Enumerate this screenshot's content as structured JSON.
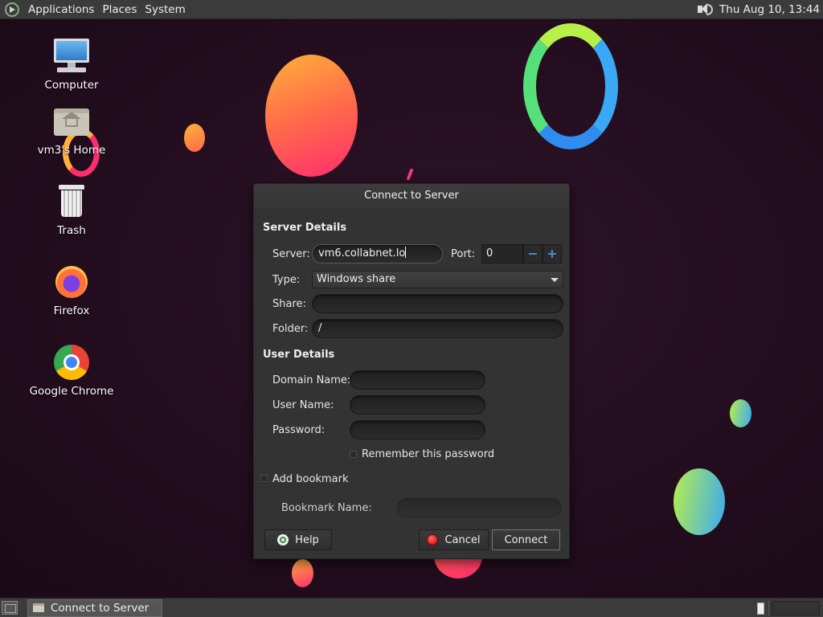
{
  "top_panel": {
    "menus": [
      "Applications",
      "Places",
      "System"
    ],
    "clock": "Thu Aug 10, 13:44",
    "volume_icon": "speaker-icon"
  },
  "desktop_icons": [
    {
      "label": "Computer",
      "icon": "computer-icon"
    },
    {
      "label": "vm3's Home",
      "icon": "home-folder-icon"
    },
    {
      "label": "Trash",
      "icon": "trash-icon"
    },
    {
      "label": "Firefox",
      "icon": "firefox-icon"
    },
    {
      "label": "Google Chrome",
      "icon": "chrome-icon"
    }
  ],
  "dialog": {
    "title": "Connect to Server",
    "server_details_heading": "Server Details",
    "server_label": "Server:",
    "server_value": "vm6.collabnet.lo",
    "port_label": "Port:",
    "port_value": "0",
    "port_decrement": "−",
    "port_increment": "+",
    "type_label": "Type:",
    "type_value": "Windows share",
    "share_label": "Share:",
    "share_value": "",
    "folder_label": "Folder:",
    "folder_value": "/",
    "user_details_heading": "User Details",
    "domain_label": "Domain Name:",
    "domain_value": "",
    "username_label": "User Name:",
    "username_value": "",
    "password_label": "Password:",
    "password_value": "",
    "remember_label": "Remember this password",
    "remember_checked": false,
    "bookmark_label": "Add bookmark",
    "bookmark_checked": false,
    "bookmark_name_label": "Bookmark Name:",
    "bookmark_name_value": "",
    "help_button": "Help",
    "cancel_button": "Cancel",
    "connect_button": "Connect"
  },
  "taskbar": {
    "window_button": "Connect to Server"
  }
}
